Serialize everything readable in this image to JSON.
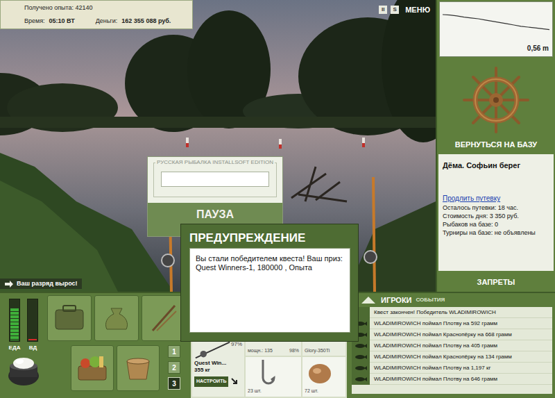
{
  "stats": {
    "experience": "Получено опыта: 42140",
    "time_label": "Время:",
    "time": "05:10 ВТ",
    "money_label": "Деньги:",
    "money": "162 355 088 руб."
  },
  "top_buttons": [
    {
      "label": "II",
      "kind": "box"
    },
    {
      "label": "S",
      "kind": "box"
    },
    {
      "label": "МЕНЮ",
      "kind": "text"
    }
  ],
  "depth": {
    "reading": "0,56 m",
    "values": [
      0.2,
      0.21,
      0.23,
      0.26,
      0.28,
      0.3,
      0.33,
      0.36,
      0.39,
      0.42,
      0.45,
      0.48,
      0.5,
      0.52,
      0.54,
      0.56
    ]
  },
  "pause": {
    "title": "РУССКАЯ РЫБАЛКА INSTALLSOFT EDITION",
    "label": "ПАУЗА"
  },
  "dialog": {
    "title": "ПРЕДУПРЕЖДЕНИЕ",
    "message": "Вы стали победителем квеста! Ваш приз: Quest Winners-1, 180000 , Опыта"
  },
  "notice": "Ваш разряд вырос!",
  "base": {
    "return": "ВЕРНУТЬСЯ НА БАЗУ",
    "name": "Дёма. Софьин берег",
    "extend": "Продлить путевку",
    "lines": [
      "Осталось путевки: 18 час.",
      "Стоимость дня: 3 350 руб.",
      "Рыбаков на базе: 0",
      "Турниры на базе: не объявлены"
    ],
    "bans": "ЗАПРЕТЫ"
  },
  "meters": [
    {
      "label": "ЕДА",
      "level": 0.8,
      "color": "#3fb03a"
    },
    {
      "label": "ВД",
      "level": 0.06,
      "color": "#d42a2a"
    }
  ],
  "slots": [
    {
      "label": "1",
      "selected": false
    },
    {
      "label": "2",
      "selected": false
    },
    {
      "label": "3",
      "selected": true
    }
  ],
  "tackle": {
    "rod_name": "Quest Win...",
    "rod_load": "355 кг",
    "rod_condition": "97%",
    "reel_power": "мощн.: 135",
    "reel_condition": "98%",
    "line_name": "Glory-350Ti",
    "hooks_count": "23 шт.",
    "bait_count": "72 шт.",
    "setup": "НАСТРОИТЬ"
  },
  "tabs": [
    {
      "label": "ИГРОКИ",
      "selected": true
    },
    {
      "label": "СОБЫТИЯ",
      "selected": false
    }
  ],
  "events": [
    {
      "text": "Квест закончен! Победитель WLADIMIROWICH",
      "kind": "system"
    },
    {
      "text": "WLADIMIROWICH поймал Плотву на 592 грамм",
      "kind": "catch"
    },
    {
      "text": "WLADIMIROWICH поймал Краснопёрку на 668 грамм",
      "kind": "catch"
    },
    {
      "text": "WLADIMIROWICH поймал Плотву на 405 грамм",
      "kind": "catch"
    },
    {
      "text": "WLADIMIROWICH поймал Краснопёрку на 134 грамм",
      "kind": "catch"
    },
    {
      "text": "WLADIMIROWICH поймал Плотву на 1,197 кг",
      "kind": "catch"
    },
    {
      "text": "WLADIMIROWICH поймал Плотву на 646 грамм",
      "kind": "catch"
    }
  ]
}
